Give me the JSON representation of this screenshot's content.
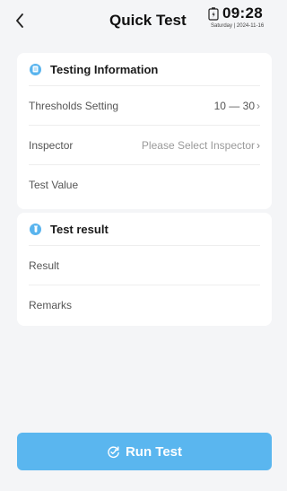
{
  "header": {
    "back_icon": "chevron-left-icon",
    "title": "Quick Test",
    "status": {
      "battery_icon": "battery-icon",
      "time": "09:28",
      "date": "Saturday | 2024-11-16"
    }
  },
  "testing_info": {
    "icon": "document-icon",
    "title": "Testing Information",
    "rows": [
      {
        "label": "Thresholds Setting",
        "value": "10 — 30",
        "placeholder": false
      },
      {
        "label": "Inspector",
        "value": "Please Select Inspector",
        "placeholder": true
      },
      {
        "label": "Test Value",
        "value": ""
      }
    ]
  },
  "test_result": {
    "icon": "tube-icon",
    "title": "Test result",
    "rows": [
      {
        "label": "Result",
        "value": ""
      },
      {
        "label": "Remarks",
        "value": ""
      }
    ]
  },
  "actions": {
    "run_label": "Run Test",
    "run_icon": "refresh-check-icon"
  },
  "colors": {
    "accent": "#5ab6ef",
    "background": "#f4f5f7",
    "card": "#ffffff"
  }
}
